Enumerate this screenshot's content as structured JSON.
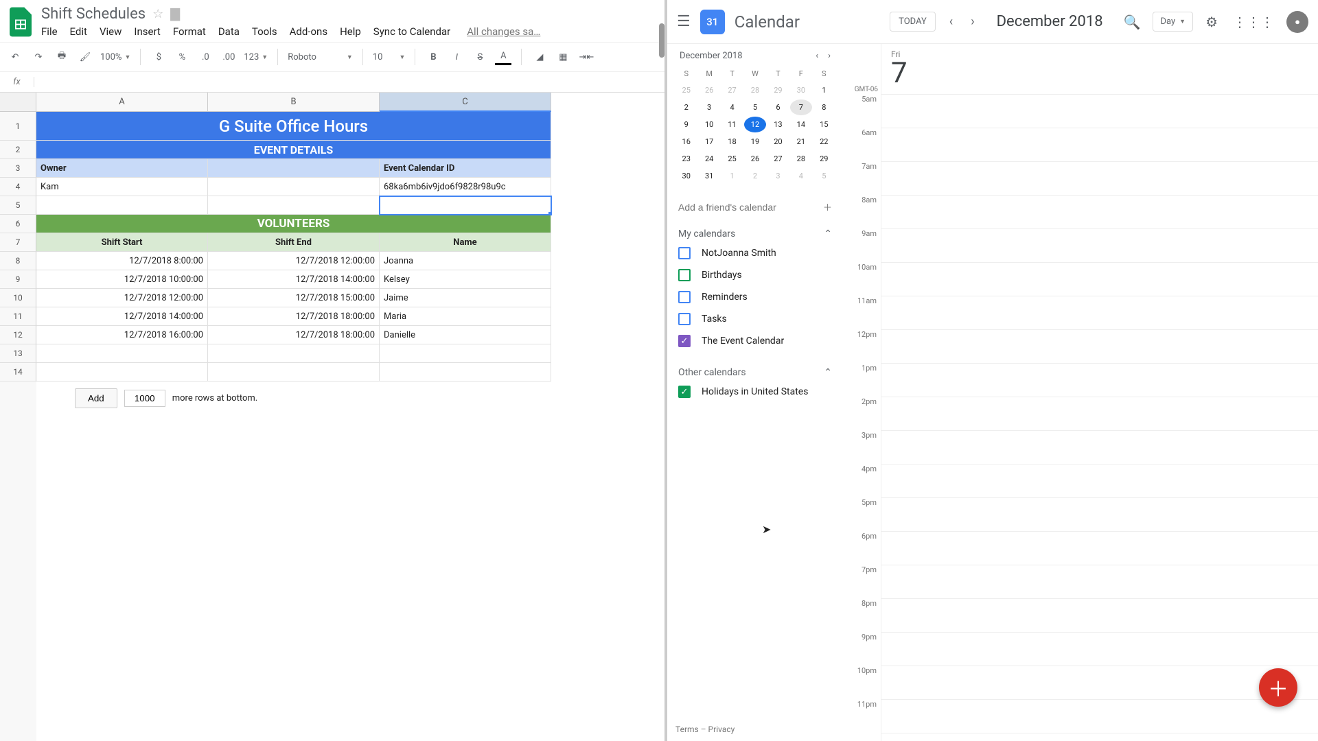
{
  "sheets": {
    "doc_title": "Shift Schedules",
    "menu": [
      "File",
      "Edit",
      "View",
      "Insert",
      "Format",
      "Data",
      "Tools",
      "Add-ons",
      "Help",
      "Sync to Calendar"
    ],
    "saved_msg": "All changes sa…",
    "toolbar": {
      "zoom": "100%",
      "fmt_num": "123",
      "font": "Roboto",
      "font_size": "10"
    },
    "columns": [
      "A",
      "B",
      "C"
    ],
    "rows_count": 14,
    "r1_title": "G Suite Office Hours",
    "r2_sub": "EVENT DETAILS",
    "r3": {
      "a": "Owner",
      "c": "Event Calendar ID"
    },
    "r4": {
      "a": "Kam",
      "c": "68ka6mb6iv9jdo6f9828r98u9c"
    },
    "r6": "VOLUNTEERS",
    "r7": {
      "a": "Shift Start",
      "b": "Shift End",
      "c": "Name"
    },
    "data_rows": [
      {
        "a": "12/7/2018 8:00:00",
        "b": "12/7/2018 12:00:00",
        "c": "Joanna"
      },
      {
        "a": "12/7/2018 10:00:00",
        "b": "12/7/2018 14:00:00",
        "c": "Kelsey"
      },
      {
        "a": "12/7/2018 12:00:00",
        "b": "12/7/2018 15:00:00",
        "c": "Jaime"
      },
      {
        "a": "12/7/2018 14:00:00",
        "b": "12/7/2018 18:00:00",
        "c": "Maria"
      },
      {
        "a": "12/7/2018 16:00:00",
        "b": "12/7/2018 18:00:00",
        "c": "Danielle"
      }
    ],
    "add_btn": "Add",
    "add_count": "1000",
    "add_suffix": "more rows at bottom."
  },
  "cal": {
    "logo": "31",
    "title": "Calendar",
    "today": "TODAY",
    "month": "December 2018",
    "view": "Day",
    "mini_month": "December 2018",
    "dow": [
      "S",
      "M",
      "T",
      "W",
      "T",
      "F",
      "S"
    ],
    "day_main": {
      "dow": "Fri",
      "dom": "7"
    },
    "tz": "GMT-06",
    "hours": [
      "5am",
      "6am",
      "7am",
      "8am",
      "9am",
      "10am",
      "11am",
      "12pm",
      "1pm",
      "2pm",
      "3pm",
      "4pm",
      "5pm",
      "6pm",
      "7pm",
      "8pm",
      "9pm",
      "10pm",
      "11pm"
    ],
    "friend_ph": "Add a friend's calendar",
    "my_label": "My calendars",
    "my": [
      {
        "name": "NotJoanna Smith",
        "color": "#4285f4",
        "checked": false
      },
      {
        "name": "Birthdays",
        "color": "#0f9d58",
        "checked": false
      },
      {
        "name": "Reminders",
        "color": "#4285f4",
        "checked": false
      },
      {
        "name": "Tasks",
        "color": "#4285f4",
        "checked": false
      },
      {
        "name": "The Event Calendar",
        "color": "#7e57c2",
        "checked": true
      }
    ],
    "other_label": "Other calendars",
    "other": [
      {
        "name": "Holidays in United States",
        "color": "#0f9d58",
        "checked": true
      }
    ],
    "footer": "Terms – Privacy",
    "mini_days": [
      {
        "n": "25",
        "o": true
      },
      {
        "n": "26",
        "o": true
      },
      {
        "n": "27",
        "o": true
      },
      {
        "n": "28",
        "o": true
      },
      {
        "n": "29",
        "o": true
      },
      {
        "n": "30",
        "o": true
      },
      {
        "n": "1"
      },
      {
        "n": "2"
      },
      {
        "n": "3"
      },
      {
        "n": "4"
      },
      {
        "n": "5"
      },
      {
        "n": "6"
      },
      {
        "n": "7",
        "sel": true
      },
      {
        "n": "8"
      },
      {
        "n": "9"
      },
      {
        "n": "10"
      },
      {
        "n": "11"
      },
      {
        "n": "12",
        "today": true
      },
      {
        "n": "13"
      },
      {
        "n": "14"
      },
      {
        "n": "15"
      },
      {
        "n": "16"
      },
      {
        "n": "17"
      },
      {
        "n": "18"
      },
      {
        "n": "19"
      },
      {
        "n": "20"
      },
      {
        "n": "21"
      },
      {
        "n": "22"
      },
      {
        "n": "23"
      },
      {
        "n": "24"
      },
      {
        "n": "25"
      },
      {
        "n": "26"
      },
      {
        "n": "27"
      },
      {
        "n": "28"
      },
      {
        "n": "29"
      },
      {
        "n": "30"
      },
      {
        "n": "31"
      },
      {
        "n": "1",
        "o": true
      },
      {
        "n": "2",
        "o": true
      },
      {
        "n": "3",
        "o": true
      },
      {
        "n": "4",
        "o": true
      },
      {
        "n": "5",
        "o": true
      }
    ]
  }
}
